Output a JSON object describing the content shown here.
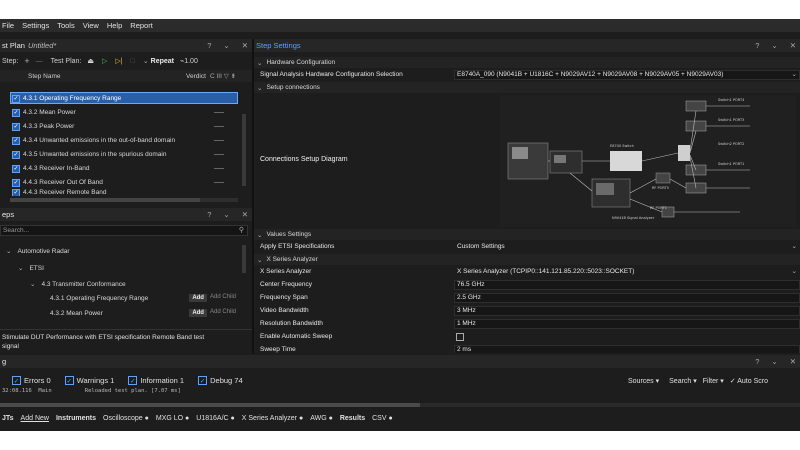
{
  "menu": [
    "File",
    "Settings",
    "Tools",
    "View",
    "Help",
    "Report"
  ],
  "test_plan": {
    "title_prefix": "st Plan",
    "title_file": "Untitled*",
    "ctrl_help": "?",
    "ctrl_menu": "⌄",
    "ctrl_close": "✕",
    "toolbar": {
      "step_label": "Step:",
      "add": "+",
      "dash": "—",
      "plan_label": "Test Plan:",
      "repeat": "Repeat",
      "repeat_value": "⌁1.00"
    },
    "col_step_name": "Step Name",
    "col_verdict": "Verdict",
    "col_icons": "C III ▽ ⇟",
    "steps": [
      "4.3.1 Operating Frequency Range",
      "4.3.2 Mean Power",
      "4.3.3 Peak Power",
      "4.3.4 Unwanted emissions in the out-of-band domain",
      "4.3.5 Unwanted emissions in the spurious domain",
      "4.4.3 Receiver In-Band",
      "4.4.3 Receiver Out Of Band",
      "4.4.3 Receiver Remote Band"
    ]
  },
  "steps_panel": {
    "title": "eps",
    "ctrl_help": "?",
    "ctrl_menu": "⌄",
    "ctrl_close": "✕",
    "search_placeholder": "Search...",
    "tree": {
      "root": "Automotive Radar",
      "etsi": "ETSI",
      "conformance": "4.3 Transmitter Conformance",
      "item1": "4.3.1 Operating Frequency Range",
      "item2": "4.3.2 Mean Power"
    },
    "add_label": "Add",
    "add_child_label": "Add Child",
    "description": "Stimulate DUT Performance with ETSI specification Remote Band test",
    "description_cut": "signal"
  },
  "step_settings": {
    "title": "Step Settings",
    "ctrl_help": "?",
    "ctrl_menu": "⌄",
    "ctrl_close": "✕",
    "hw_config": "Hardware Configuration",
    "sa_hw_label": "Signal Analysis Hardware Configuration Selection",
    "sa_hw_value": "E8740A_090 (N9041B + U1816C + N9029AV12 + N9029AV08 + N9029AV05 + N9029AV03)",
    "setup_connections": "Setup connections",
    "diagram_label": "Connections Setup Diagram",
    "values_settings": "Values Settings",
    "apply_etsi_label": "Apply ETSI Specifications",
    "apply_etsi_value": "Custom Settings",
    "xsa_section": "X Series Analyzer",
    "props": [
      {
        "label": "X Series Analyzer",
        "value": "X Series Analyzer (TCPIP0::141.121.85.220::5023::SOCKET)"
      },
      {
        "label": "Center Frequency",
        "value": "76.5 GHz"
      },
      {
        "label": "Frequency Span",
        "value": "2.5 GHz"
      },
      {
        "label": "Video Bandwidth",
        "value": "3 MHz"
      },
      {
        "label": "Resolution Bandwidth",
        "value": "1 MHz"
      },
      {
        "label": "Enable Automatic Sweep",
        "value": ""
      },
      {
        "label": "Sweep Time",
        "value": "2 ms"
      }
    ]
  },
  "log_panel": {
    "title": "g",
    "ctrl_help": "?",
    "ctrl_menu": "⌄",
    "ctrl_close": "✕",
    "errors": "Errors 0",
    "warnings": "Warnings 1",
    "information": "Information 1",
    "debug": "Debug 74",
    "sources": "Sources ▾",
    "search": "Search ▾",
    "filter": "Filter ▾",
    "auto_scroll": "✓ Auto Scro",
    "log_line": "32:08.116  Main          Reloaded test plan. [7.07 ms]"
  },
  "bottom_tabs": [
    "JTs",
    "Add New",
    "Instruments",
    "Oscilloscope ●",
    "MXG LO ●",
    "U1816A/C ●",
    "X Series Analyzer ●",
    "AWG ●",
    "Results",
    "CSV ●"
  ],
  "colors": {
    "background": "#1d1d1d",
    "accent": "#5aa2ff",
    "selected_row": "#2a5fa8",
    "header": "#262626"
  }
}
